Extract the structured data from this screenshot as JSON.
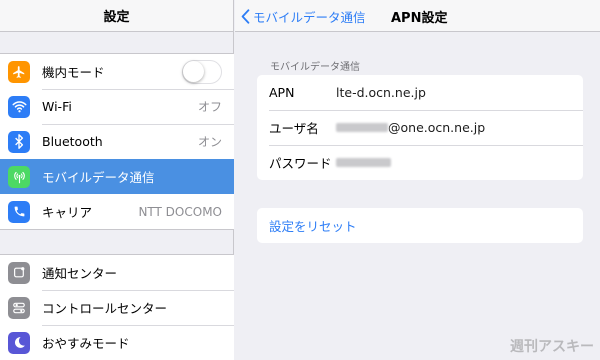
{
  "sidebar": {
    "title": "設定",
    "group1": [
      {
        "label": "機内モード",
        "icon": "airplane-icon",
        "color": "#ff9500",
        "toggle": false
      },
      {
        "label": "Wi-Fi",
        "icon": "wifi-icon",
        "color": "#2d7df6",
        "value": "オフ"
      },
      {
        "label": "Bluetooth",
        "icon": "bluetooth-icon",
        "color": "#2d7df6",
        "value": "オン"
      },
      {
        "label": "モバイルデータ通信",
        "icon": "antenna-icon",
        "color": "#4cd964",
        "selected": true
      },
      {
        "label": "キャリア",
        "icon": "phone-icon",
        "color": "#2d7df6",
        "value": "NTT DOCOMO"
      }
    ],
    "group2": [
      {
        "label": "通知センター",
        "icon": "notification-icon",
        "color": "#8e8e93"
      },
      {
        "label": "コントロールセンター",
        "icon": "control-center-icon",
        "color": "#8e8e93"
      },
      {
        "label": "おやすみモード",
        "icon": "moon-icon",
        "color": "#5856d6"
      }
    ]
  },
  "nav": {
    "back_label": "モバイルデータ通信",
    "title": "APN設定"
  },
  "section": {
    "header": "モバイルデータ通信",
    "fields": [
      {
        "label": "APN",
        "value": "lte-d.ocn.ne.jp"
      },
      {
        "label": "ユーザ名",
        "value": "@one.ocn.ne.jp",
        "masked_prefix": true
      },
      {
        "label": "パスワード",
        "value": "",
        "masked": true
      }
    ]
  },
  "reset_label": "設定をリセット",
  "watermark": "週刊アスキー",
  "colors": {
    "accent": "#2d7df6",
    "selected_row": "#4a90e2"
  }
}
